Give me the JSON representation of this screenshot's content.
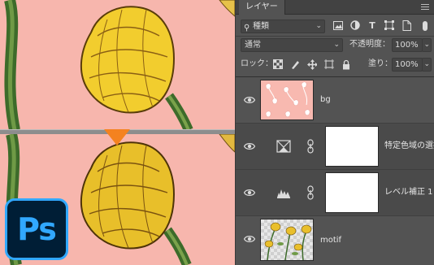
{
  "panel": {
    "tab_label": "レイヤー",
    "kind_filter": "種類",
    "blend_mode": "通常",
    "opacity_label": "不透明度：",
    "opacity_value": "100%",
    "lock_label": "ロック：",
    "fill_label": "塗り：",
    "fill_value": "100%"
  },
  "layers": [
    {
      "name": "bg",
      "type": "pixel"
    },
    {
      "name": "特定色域の選択",
      "type": "adjustment",
      "icon": "selective-color-icon"
    },
    {
      "name": "レベル補正 1",
      "type": "adjustment",
      "icon": "levels-icon"
    },
    {
      "name": "motif",
      "type": "pixel"
    }
  ],
  "app": {
    "logo_text": "Ps"
  },
  "colors": {
    "canvas_background": "#f7b6ad",
    "arrow": "#f4821f",
    "panel": "#535353",
    "logo_bg": "#001e36",
    "logo_fg": "#31a8ff"
  }
}
